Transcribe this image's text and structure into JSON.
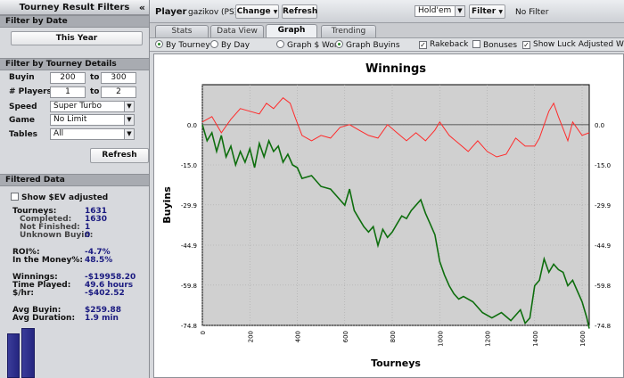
{
  "filters": {
    "title": "Tourney Result Filters",
    "collapse_glyph": "«",
    "filter_by_date": "Filter by Date",
    "date_range": "This Year",
    "filter_by_details": "Filter by Tourney Details",
    "buyin_label": "Buyin",
    "buyin_min": "200",
    "buyin_max": "300",
    "players_label": "# Players",
    "players_min": "1",
    "players_max": "2",
    "to": "to",
    "speed_label": "Speed",
    "speed_value": "Super Turbo",
    "game_label": "Game",
    "game_value": "No Limit",
    "tables_label": "Tables",
    "tables_value": "All",
    "refresh": "Refresh"
  },
  "filtered_data": {
    "title": "Filtered Data",
    "show_ev": "Show $EV adjusted",
    "rows": [
      {
        "label": "Tourneys:",
        "value": "1631",
        "sub": false
      },
      {
        "label": "Completed:",
        "value": "1630",
        "sub": true
      },
      {
        "label": "Not Finished:",
        "value": "1",
        "sub": true
      },
      {
        "label": "Unknown Buyin:",
        "value": "0",
        "sub": true
      },
      {
        "label": "ROI%:",
        "value": "-4.7%",
        "sub": false
      },
      {
        "label": "In the Money%:",
        "value": "48.5%",
        "sub": false
      },
      {
        "label": "Winnings:",
        "value": "-$19958.20",
        "sub": false
      },
      {
        "label": "Time Played:",
        "value": "49.6 hours",
        "sub": false
      },
      {
        "label": "$/hr:",
        "value": "-$402.52",
        "sub": false
      },
      {
        "label": "Avg Buyin:",
        "value": "$259.88",
        "sub": false
      },
      {
        "label": "Avg Duration:",
        "value": "1.9 min",
        "sub": false
      }
    ]
  },
  "toolbar": {
    "player_label": "Player",
    "player_name": "gazikov (PS)",
    "change": "Change",
    "refresh": "Refresh",
    "game_select": "Hold'em",
    "filter": "Filter",
    "filter_status": "No Filter"
  },
  "tabs": [
    {
      "label": "Stats",
      "active": false
    },
    {
      "label": "Data View",
      "active": false
    },
    {
      "label": "Graph",
      "active": true
    },
    {
      "label": "Trending",
      "active": false
    }
  ],
  "options": {
    "by_tourney": "By Tourney",
    "by_day": "By Day",
    "graph_won": "Graph $ Won",
    "graph_buyins": "Graph Buyins",
    "rakeback": "Rakeback",
    "bonuses": "Bonuses",
    "show_luck": "Show Luck Adjusted Winni"
  },
  "colors": {
    "accent_blue": "#1a1a80",
    "series_red": "#ff2a2a",
    "series_green": "#0e6e0e",
    "plot_bg": "#d0d0d0"
  },
  "chart_data": {
    "type": "line",
    "title": "Winnings",
    "xlabel": "Tourneys",
    "ylabel": "Buyins",
    "xlim": [
      0,
      1630
    ],
    "ylim": [
      -74.8,
      14.9
    ],
    "x_ticks": [
      0,
      200,
      400,
      600,
      800,
      1000,
      1200,
      1400,
      1600
    ],
    "y_ticks": [
      "0.0",
      "-15.0",
      "-29.9",
      "-44.9",
      "-59.8",
      "-74.8"
    ],
    "y_tick_values": [
      0.0,
      -15.0,
      -29.9,
      -44.9,
      -59.8,
      -74.8
    ],
    "grid": true,
    "series": [
      {
        "name": "",
        "color": "#ff2a2a",
        "x": [
          0,
          40,
          80,
          120,
          160,
          200,
          240,
          270,
          300,
          340,
          370,
          390,
          420,
          460,
          500,
          540,
          580,
          620,
          660,
          700,
          740,
          780,
          820,
          860,
          900,
          940,
          980,
          1000,
          1040,
          1080,
          1120,
          1160,
          1200,
          1240,
          1280,
          1320,
          1360,
          1400,
          1420,
          1460,
          1480,
          1500,
          1540,
          1560,
          1600,
          1630
        ],
        "values": [
          1,
          3,
          -3,
          2,
          6,
          5,
          4,
          8,
          6,
          10,
          8,
          3,
          -4,
          -6,
          -4,
          -5,
          -1,
          0,
          -2,
          -4,
          -5,
          0,
          -3,
          -6,
          -3,
          -6,
          -2,
          1,
          -4,
          -7,
          -10,
          -6,
          -10,
          -12,
          -11,
          -5,
          -8,
          -8,
          -5,
          5,
          8,
          3,
          -6,
          1,
          -4,
          -3
        ]
      },
      {
        "name": "",
        "color": "#0e6e0e",
        "x": [
          0,
          20,
          40,
          60,
          80,
          100,
          120,
          140,
          160,
          180,
          200,
          220,
          240,
          260,
          280,
          300,
          320,
          340,
          360,
          380,
          400,
          420,
          460,
          500,
          540,
          580,
          600,
          620,
          640,
          660,
          680,
          700,
          720,
          740,
          760,
          780,
          800,
          820,
          840,
          860,
          880,
          900,
          920,
          940,
          960,
          980,
          1000,
          1020,
          1040,
          1060,
          1080,
          1100,
          1140,
          1180,
          1220,
          1260,
          1300,
          1340,
          1360,
          1380,
          1400,
          1420,
          1440,
          1460,
          1480,
          1500,
          1520,
          1540,
          1560,
          1580,
          1600,
          1620,
          1630
        ],
        "values": [
          0,
          -6,
          -3,
          -10,
          -4,
          -12,
          -8,
          -15,
          -10,
          -14,
          -9,
          -16,
          -7,
          -12,
          -6,
          -10,
          -8,
          -14,
          -11,
          -15,
          -16,
          -20,
          -19,
          -23,
          -24,
          -28,
          -30,
          -24,
          -32,
          -35,
          -38,
          -40,
          -38,
          -45,
          -39,
          -42,
          -40,
          -37,
          -34,
          -35,
          -32,
          -30,
          -28,
          -33,
          -37,
          -41,
          -51,
          -56,
          -60,
          -63,
          -65,
          -64,
          -66,
          -70,
          -72,
          -70,
          -73,
          -69,
          -74,
          -72,
          -60,
          -58,
          -50,
          -55,
          -52,
          -54,
          -55,
          -60,
          -58,
          -62,
          -66,
          -72,
          -76
        ]
      }
    ]
  }
}
